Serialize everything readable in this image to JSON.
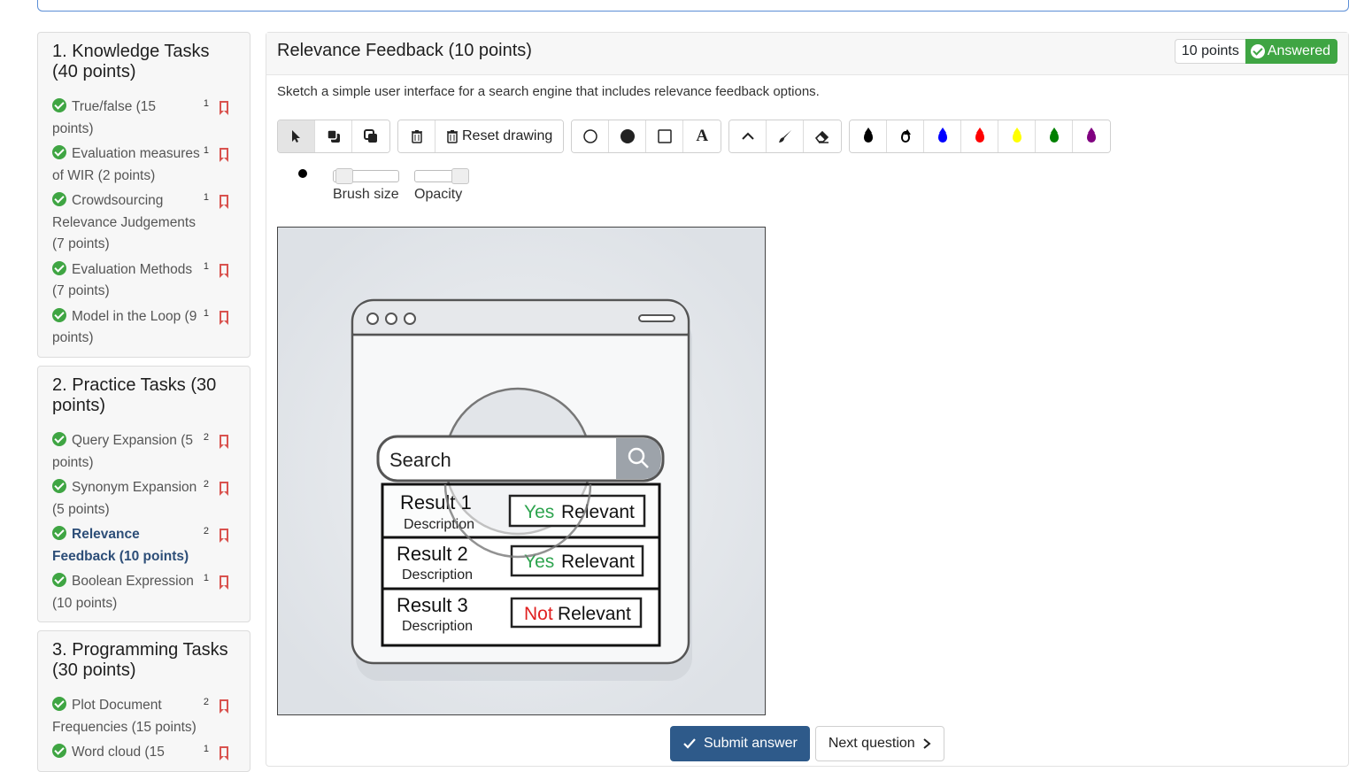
{
  "sidebar": {
    "sections": [
      {
        "title": "1. Knowledge Tasks (40 points)",
        "items": [
          {
            "label": "True/false (15 points)",
            "points": "1"
          },
          {
            "label": "Evaluation measures of WIR (2 points)",
            "points": "1"
          },
          {
            "label": "Crowdsourcing Relevance Judgements (7 points)",
            "points": "1"
          },
          {
            "label": "Evaluation Methods (7 points)",
            "points": "1"
          },
          {
            "label": "Model in the Loop (9 points)",
            "points": "1"
          }
        ]
      },
      {
        "title": "2. Practice Tasks (30 points)",
        "items": [
          {
            "label": "Query Expansion (5 points)",
            "points": "2"
          },
          {
            "label": "Synonym Expansion (5 points)",
            "points": "2"
          },
          {
            "label": "Relevance Feedback (10 points)",
            "points": "2"
          },
          {
            "label": "Boolean Expression (10 points)",
            "points": "1"
          }
        ]
      },
      {
        "title": "3. Programming Tasks (30 points)",
        "items": [
          {
            "label": "Plot Document Frequencies (15 points)",
            "points": "2"
          },
          {
            "label": "Word cloud (15",
            "points": "1"
          }
        ]
      }
    ]
  },
  "question": {
    "title": "Relevance Feedback (10 points)",
    "points_badge": "10 points",
    "status_badge": "Answered",
    "prompt": "Sketch a simple user interface for a search engine that includes relevance feedback options."
  },
  "toolbar": {
    "reset_label": "Reset drawing",
    "text_tool": "A",
    "colors": [
      "#000000",
      "#ffffff",
      "#0000ff",
      "#ff0000",
      "#ffff00",
      "#008000",
      "#800080"
    ]
  },
  "sliders": {
    "brush_label": "Brush size",
    "opacity_label": "Opacity",
    "brush_value": 0.1,
    "opacity_value": 1.0
  },
  "sketch": {
    "search_placeholder": "Search",
    "results": [
      {
        "title": "Result 1",
        "desc": "Description",
        "mark": "Yes",
        "mark_color": "#2ea44f",
        "rel": "Relevant"
      },
      {
        "title": "Result 2",
        "desc": "Description",
        "mark": "Yes",
        "mark_color": "#2ea44f",
        "rel": "Relevant"
      },
      {
        "title": "Result 3",
        "desc": "Description",
        "mark": "Not",
        "mark_color": "#e02020",
        "rel": "Relevant"
      }
    ]
  },
  "footer": {
    "submit_label": "Submit answer",
    "next_label": "Next question"
  }
}
